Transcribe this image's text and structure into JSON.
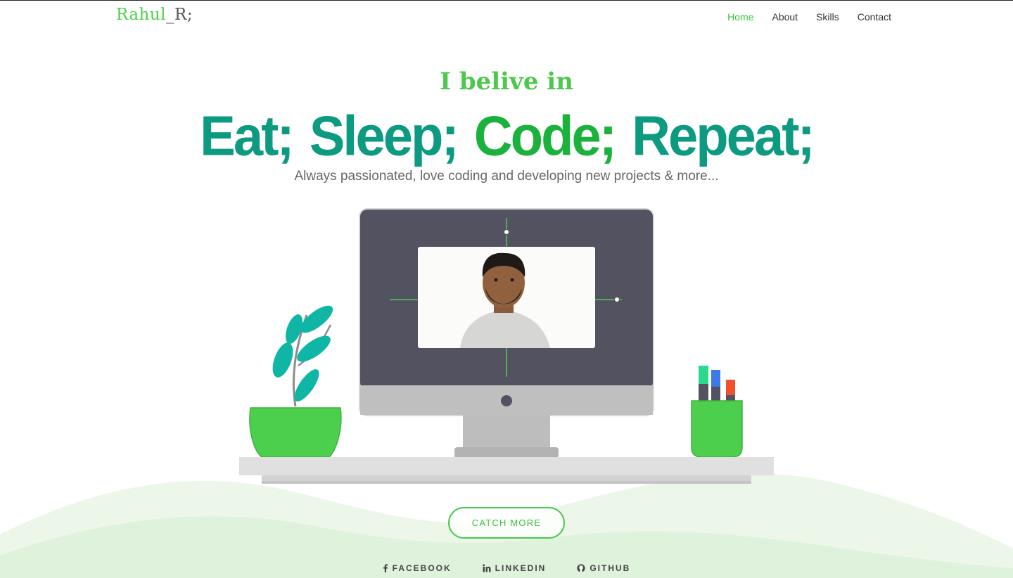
{
  "brand": {
    "part1": "Rahul",
    "part2": "_R;"
  },
  "nav": {
    "items": [
      {
        "label": "Home",
        "active": true
      },
      {
        "label": "About",
        "active": false
      },
      {
        "label": "Skills",
        "active": false
      },
      {
        "label": "Contact",
        "active": false
      }
    ]
  },
  "hero": {
    "pre": "I belive in",
    "words": [
      "Eat;",
      "Sleep;",
      "Code;",
      "Repeat;"
    ],
    "subtitle": "Always passionated, love coding and developing new projects & more..."
  },
  "cta": {
    "label": "CATCH MORE"
  },
  "social": [
    {
      "label": "FACEBOOK",
      "icon": "facebook-icon"
    },
    {
      "label": "LINKEDIN",
      "icon": "linkedin-icon"
    },
    {
      "label": "GITHUB",
      "icon": "github-icon"
    }
  ],
  "colors": {
    "accent": "#4ccf4c",
    "teal": "#0c9a80",
    "code_green": "#1ab23c",
    "monitor": "#525261",
    "plant": "#0fb5a5"
  }
}
